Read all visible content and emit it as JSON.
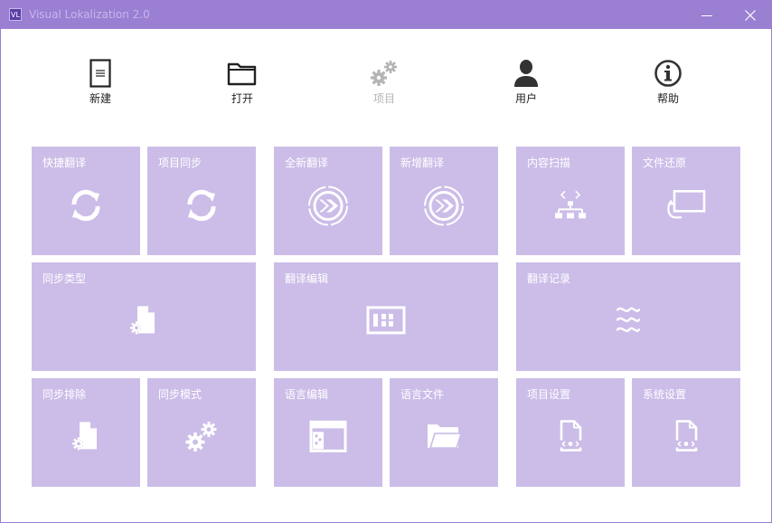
{
  "window": {
    "title": "Visual Lokalization 2.0",
    "app_icon_text": "VL",
    "minimize_label": "minimize",
    "close_label": "close"
  },
  "toolbar": {
    "items": [
      {
        "label": "新建",
        "icon": "new-document-icon",
        "enabled": true
      },
      {
        "label": "打开",
        "icon": "folder-open-icon",
        "enabled": true
      },
      {
        "label": "项目",
        "icon": "gears-icon",
        "enabled": false
      },
      {
        "label": "用户",
        "icon": "user-icon",
        "enabled": true
      },
      {
        "label": "帮助",
        "icon": "info-icon",
        "enabled": true
      }
    ]
  },
  "tiles": {
    "quick_translate": "快捷翻译",
    "project_sync": "项目同步",
    "full_translate": "全新翻译",
    "incremental_translate": "新增翻译",
    "content_scan": "内容扫描",
    "file_restore": "文件还原",
    "sync_type": "同步类型",
    "translate_edit": "翻译编辑",
    "translate_record": "翻译记录",
    "sync_exclude": "同步排除",
    "sync_mode": "同步模式",
    "language_edit": "语言编辑",
    "language_file": "语言文件",
    "project_settings": "项目设置",
    "system_settings": "系统设置"
  },
  "colors": {
    "titlebar": "#9a7fd2",
    "tile": "#cbbde8",
    "tile_text": "#ffffff",
    "disabled": "#b4b4b4"
  }
}
